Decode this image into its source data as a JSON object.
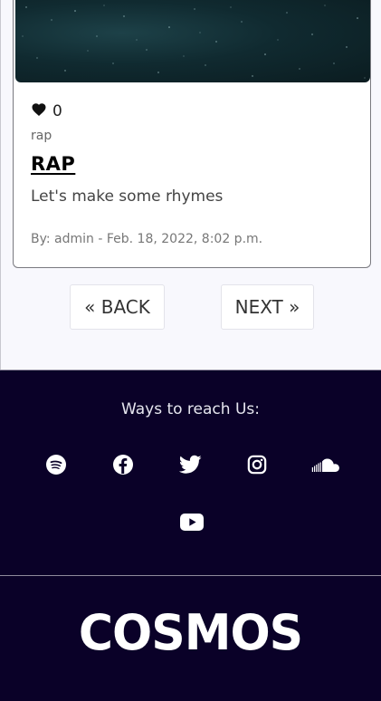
{
  "post": {
    "likes": "0",
    "category": "rap",
    "title": "RAP",
    "text": "Let's make some rhymes",
    "meta": "By: admin - Feb. 18, 2022, 8:02 p.m."
  },
  "pagination": {
    "back_label": "« BACK",
    "next_label": "NEXT »"
  },
  "footer": {
    "heading": "Ways to reach Us:",
    "socials": [
      "spotify-icon",
      "facebook-icon",
      "twitter-icon",
      "instagram-icon",
      "soundcloud-icon",
      "youtube-icon"
    ],
    "brand": "COSMOS"
  },
  "colors": {
    "footer_bg": "#0a0128",
    "page_bg": "#f8f8fd"
  }
}
